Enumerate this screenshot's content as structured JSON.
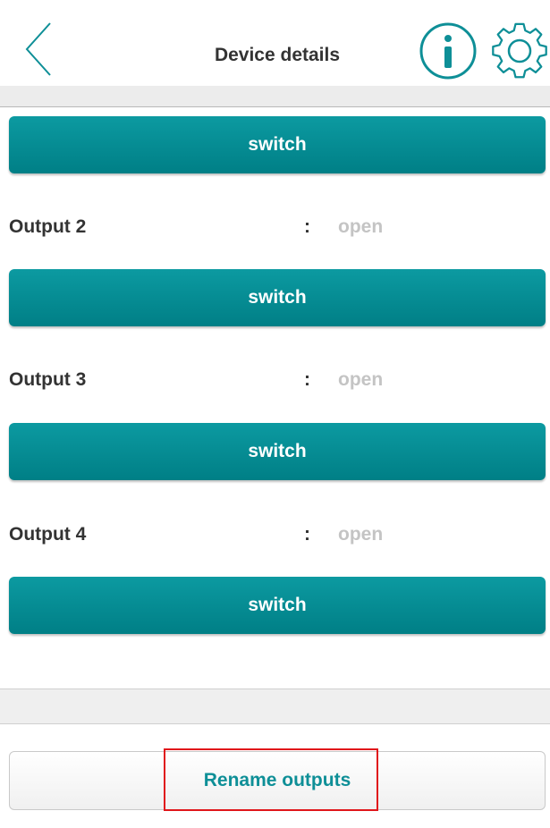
{
  "header": {
    "title": "Device details",
    "back_icon": "chevron-left-icon",
    "info_icon": "info-icon",
    "settings_icon": "gear-icon",
    "accent_color": "#0e8f97"
  },
  "switch_label": "switch",
  "outputs": [
    {
      "label": "Output 2",
      "separator": ":",
      "state": "open"
    },
    {
      "label": "Output 3",
      "separator": ":",
      "state": "open"
    },
    {
      "label": "Output 4",
      "separator": ":",
      "state": "open"
    }
  ],
  "switches": [
    "switch",
    "switch",
    "switch",
    "switch"
  ],
  "footer": {
    "rename_label": "Rename outputs",
    "highlight_color": "#e0161b"
  }
}
